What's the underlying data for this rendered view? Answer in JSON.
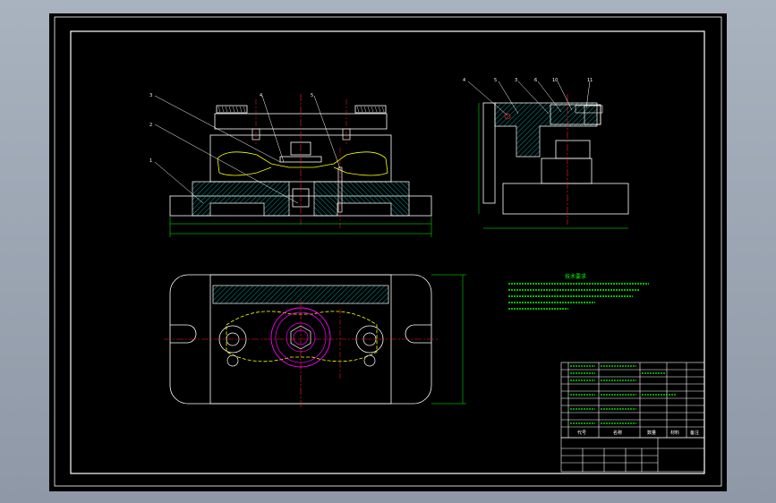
{
  "colors": {
    "outline": "#ffffff",
    "center": "#ff2020",
    "hatch": "#00c8c8",
    "dim": "#00ff00",
    "yellow": "#ffff00",
    "magenta": "#ff00ff",
    "background": "#000000",
    "frame_bg": "#a4adba"
  },
  "front_view": {
    "balloons": [
      "3",
      "4",
      "5",
      "2",
      "1"
    ]
  },
  "side_view": {
    "balloons": [
      "4",
      "5",
      "3",
      "6",
      "10",
      "11"
    ]
  },
  "notes": {
    "title": "技术要求",
    "lines": [
      "",
      "",
      "",
      "",
      ""
    ]
  },
  "title_block": {
    "cell_a": "代号",
    "cell_b": "名称",
    "cell_c": "数量",
    "cell_d": "材料",
    "cell_e": "备注"
  }
}
